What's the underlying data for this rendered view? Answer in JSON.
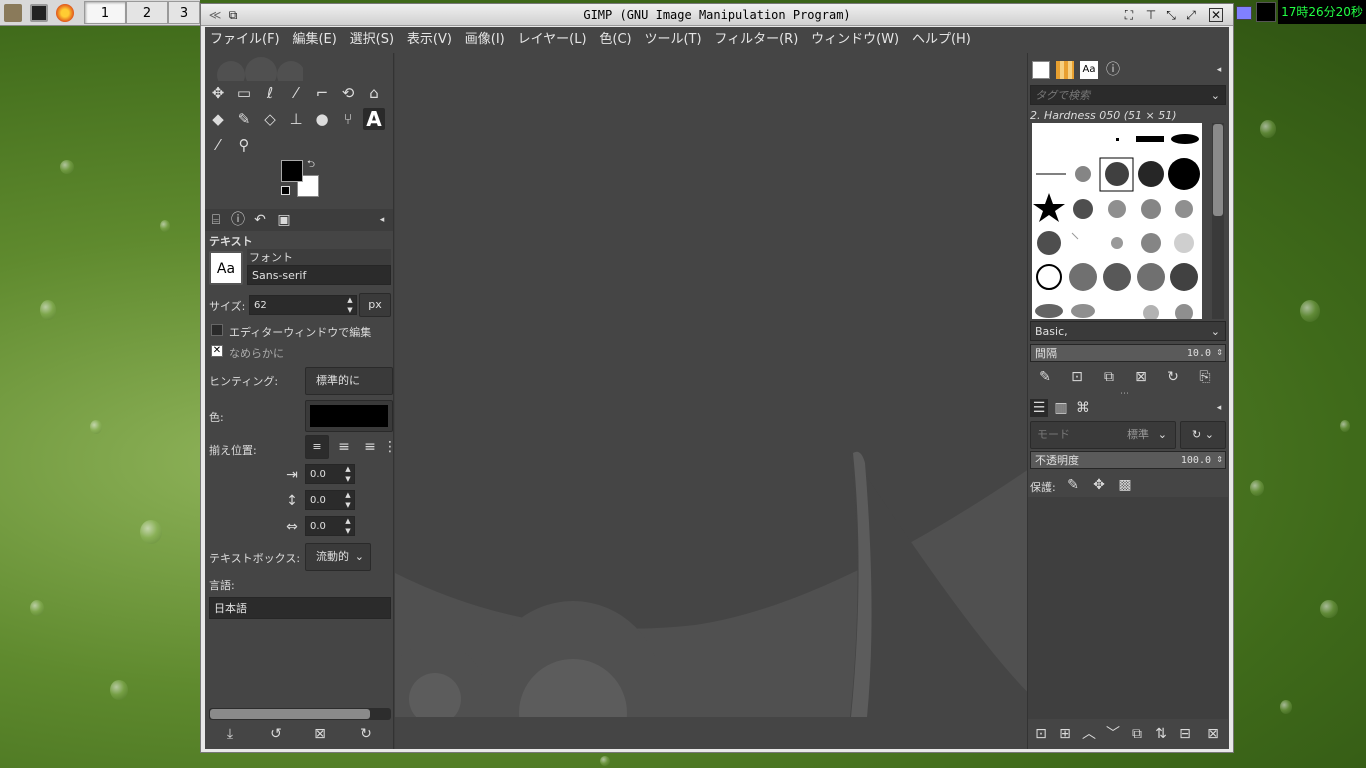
{
  "taskbar": {
    "workspaces": [
      "1",
      "2",
      "3"
    ],
    "clock": "17時26分20秒"
  },
  "window": {
    "title": "GIMP (GNU Image Manipulation Program)"
  },
  "menubar": {
    "items": [
      "ファイル(F)",
      "編集(E)",
      "選択(S)",
      "表示(V)",
      "画像(I)",
      "レイヤー(L)",
      "色(C)",
      "ツール(T)",
      "フィルター(R)",
      "ウィンドウ(W)",
      "ヘルプ(H)"
    ]
  },
  "tool_options": {
    "title": "テキスト",
    "font_label": "フォント",
    "font_preview": "Aa",
    "font_value": "Sans-serif",
    "size_label": "サイズ:",
    "size_value": "62",
    "size_unit": "px",
    "use_editor_label": "エディターウィンドウで編集",
    "use_editor_checked": false,
    "antialias_label": "なめらかに",
    "antialias_checked": true,
    "hinting_label": "ヒンティング:",
    "hinting_value": "標準的に",
    "color_label": "色:",
    "color_value": "#000000",
    "justify_label": "揃え位置:",
    "indent_value": "0.0",
    "line_spacing_value": "0.0",
    "letter_spacing_value": "0.0",
    "textbox_label": "テキストボックス:",
    "textbox_value": "流動的",
    "language_label": "言語:",
    "language_value": "日本語"
  },
  "brushes": {
    "tag_placeholder": "タグで検索",
    "selected_brush": "2. Hardness 050 (51 × 51)",
    "preset": "Basic,",
    "spacing_label": "間隔",
    "spacing_value": "10.0"
  },
  "layers": {
    "mode_label": "モード",
    "mode_value": "標準",
    "opacity_label": "不透明度",
    "opacity_value": "100.0",
    "lock_label": "保護:"
  },
  "colors": {
    "accent": "#454545",
    "clock_text": "#22ff44",
    "foreground": "#000000",
    "background": "#ffffff"
  }
}
